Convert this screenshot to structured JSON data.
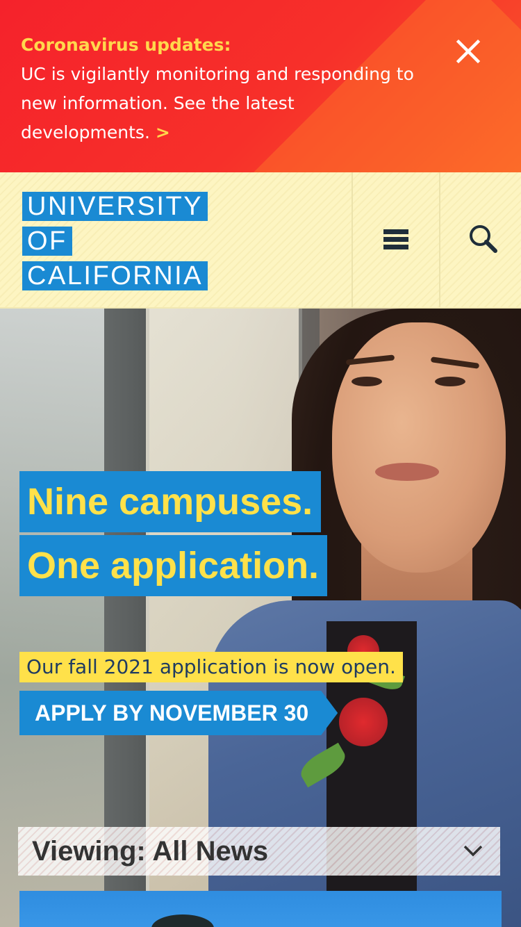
{
  "alert": {
    "title": "Coronavirus updates:",
    "body": "UC is vigilantly monitoring and responding to new information. See the latest developments.",
    "chevron": ">",
    "close_icon": "close-icon",
    "colors": {
      "background": "#f5222b",
      "title": "#ffd84d"
    }
  },
  "header": {
    "logo_lines": [
      "UNIVERSITY",
      "OF",
      "CALIFORNIA"
    ],
    "menu_icon": "hamburger-menu-icon",
    "search_icon": "search-icon",
    "colors": {
      "logo": "#1a8ad3",
      "background": "#fdf5c2"
    }
  },
  "hero": {
    "headline_1": "Nine campuses.",
    "headline_2": "One application.",
    "subtext": "Our fall 2021 application is now open.",
    "cta": "APPLY BY NOVEMBER 30",
    "colors": {
      "headline_bg": "#1a8ad3",
      "headline_text": "#ffe14a"
    }
  },
  "news_filter": {
    "label": "Viewing: All News",
    "chevron_icon": "chevron-down-icon"
  }
}
